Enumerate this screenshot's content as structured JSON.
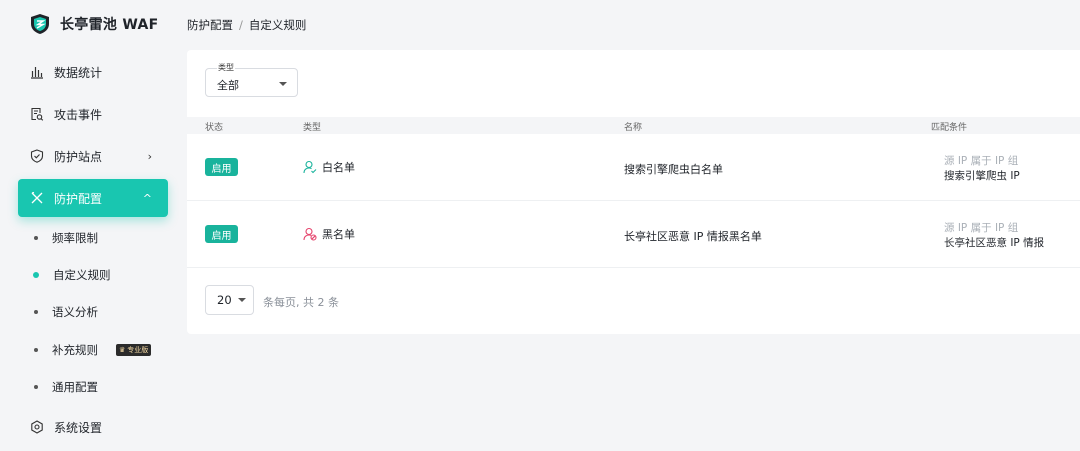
{
  "app": {
    "title": "长亭雷池 WAF",
    "accent_color": "#19c6b0",
    "logo_icon": "shield-logo-icon"
  },
  "sidebar": {
    "items": [
      {
        "label": "数据统计",
        "icon": "bar-chart-icon"
      },
      {
        "label": "攻击事件",
        "icon": "document-search-icon"
      },
      {
        "label": "防护站点",
        "icon": "shield-check-icon",
        "arrow": "›"
      },
      {
        "label": "防护配置",
        "icon": "tools-icon",
        "arrow": "^",
        "active": true
      },
      {
        "label": "系统设置",
        "icon": "gear-icon"
      }
    ],
    "sub_items": [
      {
        "label": "频率限制"
      },
      {
        "label": "自定义规则",
        "current": true
      },
      {
        "label": "语义分析"
      },
      {
        "label": "补充规则",
        "badge": "专业版"
      },
      {
        "label": "通用配置"
      }
    ]
  },
  "breadcrumb": {
    "parent": "防护配置",
    "separator": "/",
    "current": "自定义规则"
  },
  "filter": {
    "label": "类型",
    "value": "全部"
  },
  "table": {
    "headers": {
      "status": "状态",
      "type": "类型",
      "name": "名称",
      "condition": "匹配条件"
    },
    "rows": [
      {
        "status": "启用",
        "type": "白名单",
        "type_icon": "user-check-icon",
        "name": "搜索引擎爬虫白名单",
        "condition_line1": "源 IP 属于 IP 组",
        "condition_line2": "搜索引擎爬虫 IP"
      },
      {
        "status": "启用",
        "type": "黑名单",
        "type_icon": "user-block-icon",
        "name": "长亭社区恶意 IP 情报黑名单",
        "condition_line1": "源 IP 属于 IP 组",
        "condition_line2": "长亭社区恶意 IP 情报"
      }
    ]
  },
  "pagination": {
    "page_size": "20",
    "summary": "条每页, 共 2 条"
  }
}
